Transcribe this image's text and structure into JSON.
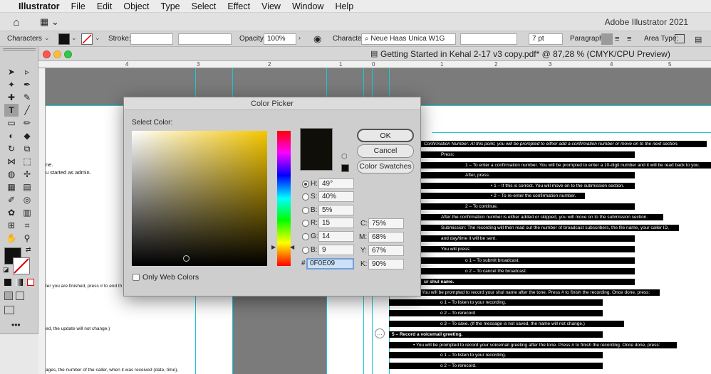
{
  "menubar": {
    "apple": "",
    "items": [
      "Illustrator",
      "File",
      "Edit",
      "Object",
      "Type",
      "Select",
      "Effect",
      "View",
      "Window",
      "Help"
    ]
  },
  "appbar": {
    "title": "Adobe Illustrator 2021",
    "home_icon": "home-icon",
    "workspace_icon": "workspace-switcher-icon"
  },
  "control": {
    "panel_label": "Characters",
    "stroke_label": "Stroke:",
    "opacity_label": "Opacity:",
    "opacity_value": "100%",
    "character_label": "Character:",
    "font_value": "Neue Haas Unica W1G",
    "size_value": "7 pt",
    "paragraph_label": "Paragraph:",
    "area_type_label": "Area Type:"
  },
  "document": {
    "tab_title": "Getting Started in Kehal 2-17 v3 copy.pdf* @ 87,28 % (CMYK/CPU Preview)",
    "ruler_marks": [
      "4",
      "3",
      "2",
      "1",
      "0",
      "1",
      "2",
      "3",
      "4",
      "5"
    ],
    "left_text": [
      "ne.",
      "u started as admin.",
      "ter you are finished, press # to end th",
      "ed, the update will not change.)",
      "ages, the number of the caller, when it was received (date, time),"
    ],
    "right_lines": [
      "Confirmation Number: At this point, you will be prompted to either add a confirmation number or move on to the next section.",
      "Press:",
      "1 – To enter a confirmation number. You will be prompted to enter a 10-digit number and it will be read back to you.",
      "After, press:",
      "•   1 – If this is correct. You will move on to the submission section.",
      "•   2 – To re-enter the confirmation number.",
      "2 – To continue.",
      "After the confirmation number is either added or skipped, you will move on to the submission section.",
      "Submission: The recording will then read out the number of broadcast subscribers, the file name, your caller ID,",
      "and day/time it will be sent.",
      "You will press:",
      "o    1 – To submit broadcast.",
      "o    2 – To cancel the broadcast.",
      "ur shul name.",
      "You will be prompted to record your shul name after the tone. Press # to finish the recording.  Once done, press:",
      "o    1 – To listen to your recording.",
      "o    2 – To rerecord",
      "o    3 – To save. (If the message is not saved, the name will not change.)",
      "5 – Record a voicemail greeting.",
      "•    You will be prompted to record your voicemail greeting after the tone. Press # to finish the recording. Once done, press:",
      "o    1 – To listen to your recording.",
      "o    2 – To rerecord."
    ]
  },
  "dialog": {
    "title": "Color Picker",
    "select_color_label": "Select Color:",
    "ok": "OK",
    "cancel": "Cancel",
    "swatches": "Color Swatches",
    "only_web_colors": "Only Web Colors",
    "fields": {
      "H_label": "H:",
      "H": "49°",
      "S_label": "S:",
      "S": "40%",
      "B_label": "B:",
      "B": "5%",
      "R_label": "R:",
      "R": "15",
      "G_label": "G:",
      "G": "14",
      "Bl_label": "B:",
      "Bl": "9",
      "hash": "#",
      "hex": "0F0E09",
      "C_label": "C:",
      "C": "75%",
      "M_label": "M:",
      "M": "68%",
      "Y_label": "Y:",
      "Y": "67%",
      "K_label": "K:",
      "K": "90%"
    },
    "current_color": "#0F0E09"
  },
  "colors": {
    "accent": "#19c9d6",
    "selected_field": "#cde0f7"
  }
}
